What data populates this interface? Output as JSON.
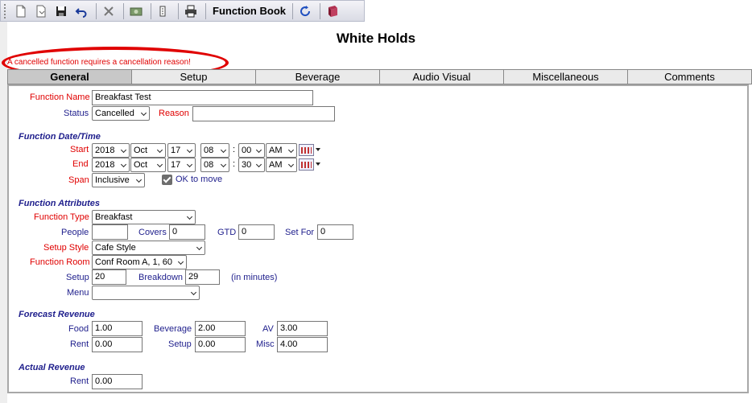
{
  "toolbar": {
    "icons": [
      "new-icon",
      "copy-icon",
      "save-icon",
      "undo-icon",
      "delete-icon",
      "money-icon",
      "print-preview-icon",
      "print-icon",
      "refresh-icon",
      "function-book-icon"
    ],
    "function_book_label": "Function Book"
  },
  "page": {
    "title": "White Holds",
    "error_message": "A cancelled function requires a cancellation reason!"
  },
  "tabs": [
    {
      "label": "General",
      "active": true
    },
    {
      "label": "Setup"
    },
    {
      "label": "Beverage"
    },
    {
      "label": "Audio Visual"
    },
    {
      "label": "Miscellaneous"
    },
    {
      "label": "Comments"
    }
  ],
  "general": {
    "function_name_label": "Function Name",
    "function_name_value": "Breakfast Test",
    "status_label": "Status",
    "status_value": "Cancelled",
    "reason_label": "Reason",
    "reason_value": "",
    "datetime_section": "Function Date/Time",
    "start_label": "Start",
    "start": {
      "year": "2018",
      "month": "Oct",
      "day": "17",
      "hour": "08",
      "minute": "00",
      "ampm": "AM"
    },
    "end_label": "End",
    "end": {
      "year": "2018",
      "month": "Oct",
      "day": "17",
      "hour": "08",
      "minute": "30",
      "ampm": "AM"
    },
    "colon": ":",
    "span_label": "Span",
    "span_value": "Inclusive",
    "ok_to_move_label": "OK to move",
    "ok_to_move_checked": true,
    "attributes_section": "Function Attributes",
    "function_type_label": "Function Type",
    "function_type_value": "Breakfast",
    "people_label": "People",
    "people_value": "",
    "covers_label": "Covers",
    "covers_value": "0",
    "gtd_label": "GTD",
    "gtd_value": "0",
    "set_for_label": "Set For",
    "set_for_value": "0",
    "setup_style_label": "Setup Style",
    "setup_style_value": "Cafe Style",
    "function_room_label": "Function Room",
    "function_room_value": "Conf Room A, 1, 60",
    "setup_label": "Setup",
    "setup_value": "20",
    "breakdown_label": "Breakdown",
    "breakdown_value": "29",
    "minutes_note": "(in minutes)",
    "menu_label": "Menu",
    "menu_value": "",
    "forecast_section": "Forecast Revenue",
    "food_label": "Food",
    "food_value": "1.00",
    "beverage_label": "Beverage",
    "beverage_value": "2.00",
    "av_label": "AV",
    "av_value": "3.00",
    "rent_label": "Rent",
    "rent_value": "0.00",
    "setup_rev_label": "Setup",
    "setup_rev_value": "0.00",
    "misc_label": "Misc",
    "misc_value": "4.00",
    "actual_section": "Actual Revenue",
    "actual_rent_label": "Rent",
    "actual_rent_value": "0.00"
  },
  "colors": {
    "required_label": "#e00000",
    "label": "#1e1e8c",
    "error_ellipse": "#e00000"
  }
}
